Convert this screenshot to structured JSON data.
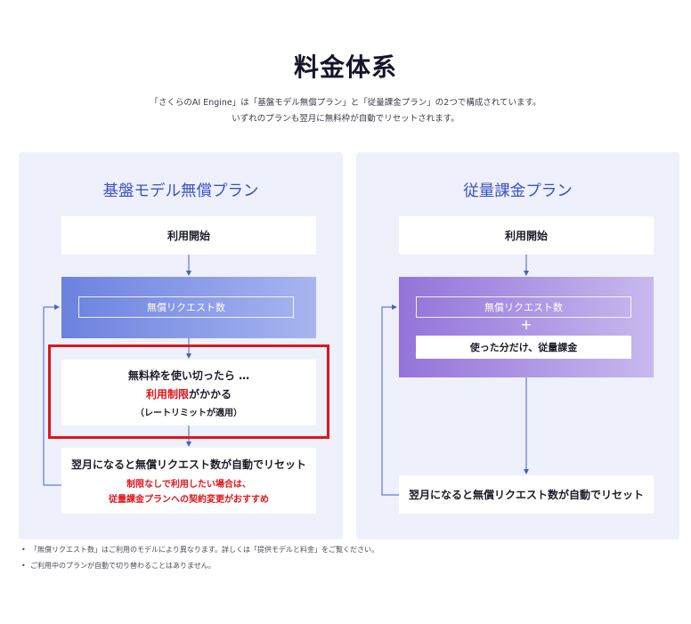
{
  "title": "料金体系",
  "subtitle_1": "「さくらのAI Engine」は「基盤モデル無償プラン」と「従量課金プラン」の2つで構成されています。",
  "subtitle_2": "いずれのプランも翌月に無料枠が自動でリセットされます。",
  "left_plan": {
    "title": "基盤モデル無償プラン",
    "start": "利用開始",
    "free_requests": "無償リクエスト数",
    "limit_line1": "無料枠を使い切ったら …",
    "limit_red": "利用制限",
    "limit_suffix": "がかかる",
    "limit_note": "（レートリミットが適用）",
    "reset": "翌月になると無償リクエスト数が自動でリセット",
    "reset_note_1": "制限なしで利用したい場合は、",
    "reset_note_2": "従量課金プランへの契約変更がおすすめ"
  },
  "right_plan": {
    "title": "従量課金プラン",
    "start": "利用開始",
    "free_requests": "無償リクエスト数",
    "plus": "+",
    "metered": "使った分だけ、従量課金",
    "reset": "翌月になると無償リクエスト数が自動でリセット"
  },
  "notes": [
    "「無償リクエスト数」はご利用のモデルにより異なります。詳しくは「提供モデルと料金」をご覧ください。",
    "ご利用中のプランが自動で切り替わることはありません。"
  ],
  "colors": {
    "accent_blue": "#3b52c4",
    "panel_bg": "#eef0fc",
    "highlight_red": "#e0151b",
    "gradient_blue": "#6b82df",
    "gradient_purple": "#9373d9"
  }
}
